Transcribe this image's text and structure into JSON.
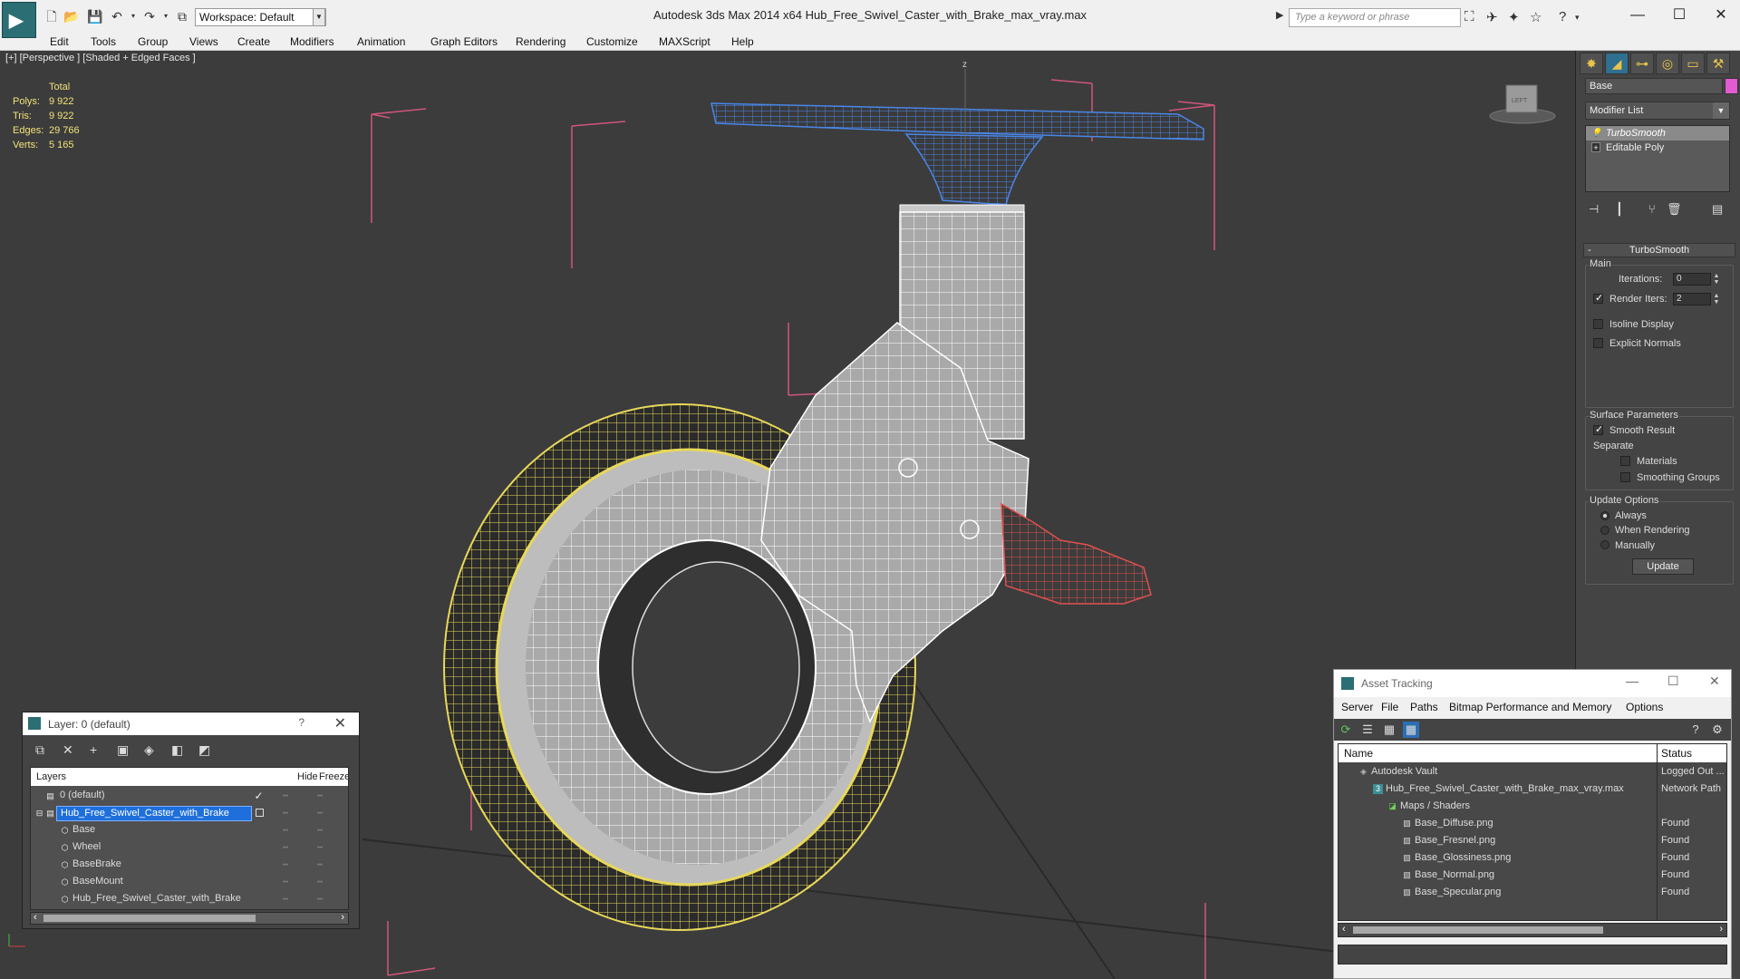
{
  "app": {
    "title": "Autodesk 3ds Max  2014 x64     Hub_Free_Swivel_Caster_with_Brake_max_vray.max",
    "workspace": "Workspace: Default",
    "search_placeholder": "Type a keyword or phrase"
  },
  "menu": [
    "Edit",
    "Tools",
    "Group",
    "Views",
    "Create",
    "Modifiers",
    "Animation",
    "Graph Editors",
    "Rendering",
    "Customize",
    "MAXScript",
    "Help"
  ],
  "viewport": {
    "label": "[+] [Perspective ] [Shaded + Edged Faces ]",
    "stats": {
      "total_label": "Total",
      "rows": [
        {
          "k": "Polys:",
          "v": "9 922"
        },
        {
          "k": "Tris:",
          "v": "9 922"
        },
        {
          "k": "Edges:",
          "v": "29 766"
        },
        {
          "k": "Verts:",
          "v": "5 165"
        }
      ]
    },
    "colors": {
      "background": "#3c3c3c",
      "bbox": "#d0567a",
      "wheel_wire": "#e8d85a",
      "base_wire": "#4a86e8",
      "brake_wire": "#e05050",
      "mesh": "#9a9a9a"
    }
  },
  "command_panel": {
    "object_name": "Base",
    "object_color": "#e35bd0",
    "modifier_list": "Modifier List",
    "stack": [
      {
        "label": "TurboSmooth",
        "selected": true,
        "icon": "lightbulb-icon"
      },
      {
        "label": "Editable Poly",
        "selected": false,
        "icon": "plus-icon"
      }
    ],
    "rollout_title": "TurboSmooth",
    "main_label": "Main",
    "iterations_label": "Iterations:",
    "iterations_value": "0",
    "render_iters_label": "Render Iters:",
    "render_iters_value": "2",
    "render_iters_checked": true,
    "isoline_label": "Isoline Display",
    "explicit_label": "Explicit Normals",
    "surface_label": "Surface Parameters",
    "smooth_label": "Smooth Result",
    "smooth_checked": true,
    "separate_label": "Separate",
    "materials_label": "Materials",
    "smoothing_label": "Smoothing Groups",
    "update_options_label": "Update Options",
    "always_label": "Always",
    "when_rendering_label": "When Rendering",
    "manually_label": "Manually",
    "update_button": "Update"
  },
  "layer_window": {
    "title": "Layer: 0 (default)",
    "help": "?",
    "col_layers": "Layers",
    "col_hide": "Hide",
    "col_freeze": "Freeze",
    "rows": [
      {
        "name": "0 (default)",
        "indent": 0,
        "selected": false,
        "current": true
      },
      {
        "name": "Hub_Free_Swivel_Caster_with_Brake",
        "indent": 0,
        "selected": true,
        "current": false
      },
      {
        "name": "Base",
        "indent": 1,
        "selected": false,
        "current": false
      },
      {
        "name": "Wheel",
        "indent": 1,
        "selected": false,
        "current": false
      },
      {
        "name": "BaseBrake",
        "indent": 1,
        "selected": false,
        "current": false
      },
      {
        "name": "BaseMount",
        "indent": 1,
        "selected": false,
        "current": false
      },
      {
        "name": "Hub_Free_Swivel_Caster_with_Brake",
        "indent": 1,
        "selected": false,
        "current": false
      }
    ]
  },
  "asset_tracking": {
    "title": "Asset Tracking",
    "menu": [
      "Server",
      "File",
      "Paths",
      "Bitmap Performance and Memory",
      "Options"
    ],
    "col_name": "Name",
    "col_status": "Status",
    "rows": [
      {
        "name": "Autodesk Vault",
        "status": "Logged Out ...",
        "indent": 1,
        "icon": "vault-icon"
      },
      {
        "name": "Hub_Free_Swivel_Caster_with_Brake_max_vray.max",
        "status": "Network Path",
        "indent": 2,
        "icon": "max-file-icon"
      },
      {
        "name": "Maps / Shaders",
        "status": "",
        "indent": 3,
        "icon": "maps-icon"
      },
      {
        "name": "Base_Diffuse.png",
        "status": "Found",
        "indent": 4,
        "icon": "image-file-icon"
      },
      {
        "name": "Base_Fresnel.png",
        "status": "Found",
        "indent": 4,
        "icon": "image-file-icon"
      },
      {
        "name": "Base_Glossiness.png",
        "status": "Found",
        "indent": 4,
        "icon": "image-file-icon"
      },
      {
        "name": "Base_Normal.png",
        "status": "Found",
        "indent": 4,
        "icon": "image-file-icon"
      },
      {
        "name": "Base_Specular.png",
        "status": "Found",
        "indent": 4,
        "icon": "image-file-icon"
      }
    ]
  }
}
